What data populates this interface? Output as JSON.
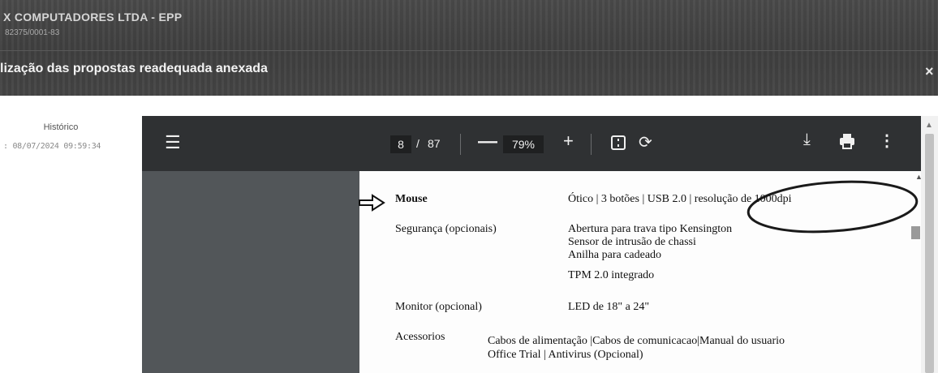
{
  "header": {
    "company": "X COMPUTADORES LTDA - EPP",
    "cnpj": "82375/0001-83",
    "document_title": "lização das propostas readequada anexada",
    "close_label": "×"
  },
  "history": {
    "label": "Histórico",
    "date": ": 08/07/2024 09:59:34"
  },
  "viewer": {
    "menu_icon": "menu-icon",
    "page_current": "8",
    "page_separator": "/",
    "page_total": "87",
    "zoom": "79%",
    "minus": "—",
    "plus": "+",
    "download_icon": "download-icon",
    "print_icon": "print-icon",
    "more_icon": "more-vert-icon"
  },
  "document": {
    "rows": [
      {
        "label": "Mouse",
        "value": "Ótico | 3 botões | USB 2.0 | resolução de 1000dpi"
      },
      {
        "label": "Segurança (opcionais)",
        "value": "Abertura para trava tipo Kensington"
      },
      {
        "label": "",
        "value": "Sensor de intrusão de chassi"
      },
      {
        "label": "",
        "value": "Anilha para cadeado"
      },
      {
        "label": "",
        "value": "TPM 2.0 integrado"
      },
      {
        "label": "Monitor (opcional)",
        "value": "LED de 18\" a 24\""
      },
      {
        "label": "Acessorios",
        "value": "Cabos de alimentação |Cabos de comunicacao|Manual do usuario"
      },
      {
        "label": "",
        "value": "Office Trial | Antivirus (Opcional)"
      }
    ]
  },
  "colors": {
    "header_bg": "#434343",
    "toolbar_bg": "#2f3133",
    "viewer_bg": "#525659",
    "page_bg": "#fdfdfd",
    "annotation": "#1a1a1a"
  }
}
